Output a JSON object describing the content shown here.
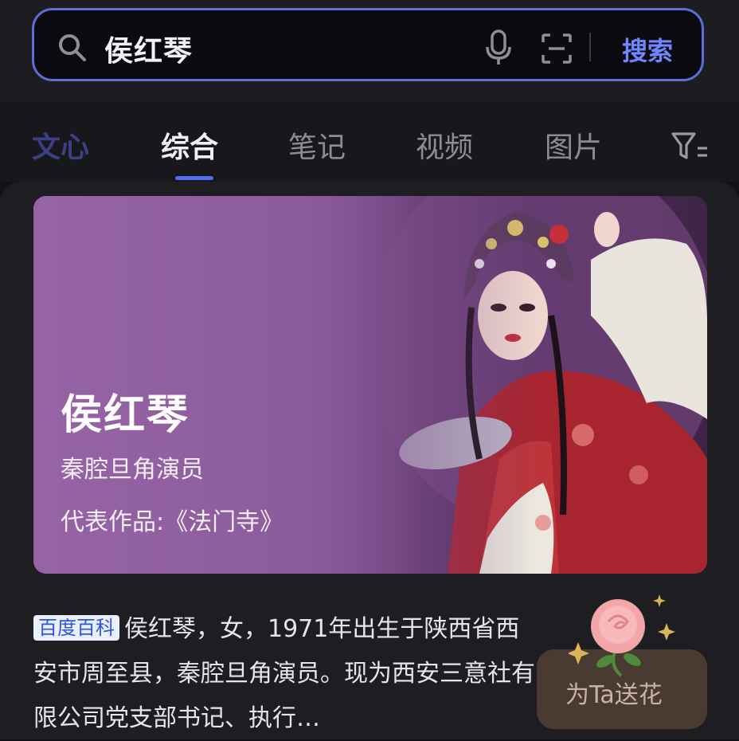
{
  "search": {
    "query": "侯红琴",
    "button_label": "搜索",
    "icons": [
      "search-icon",
      "microphone-icon",
      "scan-icon"
    ]
  },
  "tabs": [
    {
      "label": "文心",
      "state": "brand"
    },
    {
      "label": "综合",
      "state": "active"
    },
    {
      "label": "笔记",
      "state": "inactive"
    },
    {
      "label": "视频",
      "state": "inactive"
    },
    {
      "label": "图片",
      "state": "inactive"
    }
  ],
  "tab_filter_icon": "filter-icon",
  "hero": {
    "name": "侯红琴",
    "role": "秦腔旦角演员",
    "works_label": "代表作品:",
    "works_value": "《法门寺》"
  },
  "baike": {
    "badge": "百度百科",
    "text": "侯红琴，女，1971年出生于陕西省西安市周至县，秦腔旦角演员。现为西安三意社有限公司党支部书记、执行…"
  },
  "flower_button": {
    "label": "为Ta送花",
    "icon": "rose-icon"
  },
  "colors": {
    "accent": "#5b6ed8",
    "search_button": "#6f86ff",
    "tab_underline": "#4f6ef0",
    "hero_purple": "#9b66a6",
    "background": "#111116"
  }
}
